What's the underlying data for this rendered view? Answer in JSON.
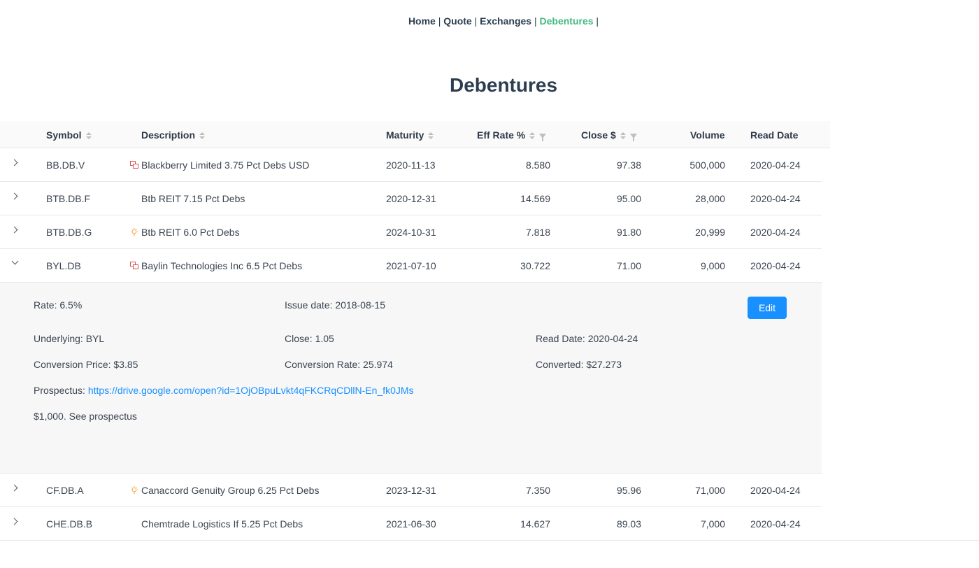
{
  "nav": {
    "home": "Home",
    "quote": "Quote",
    "exchanges": "Exchanges",
    "debentures": "Debentures",
    "sep": "|"
  },
  "page_title": "Debentures",
  "columns": {
    "symbol": "Symbol",
    "description": "Description",
    "maturity": "Maturity",
    "eff_rate": "Eff Rate %",
    "close": "Close $",
    "volume": "Volume",
    "read_date": "Read Date"
  },
  "rows": [
    {
      "symbol": "BB.DB.V",
      "icon": "convert-icon",
      "description": "Blackberry Limited 3.75 Pct Debs USD",
      "maturity": "2020-11-13",
      "eff_rate": "8.580",
      "close": "97.38",
      "volume": "500,000",
      "read_date": "2020-04-24"
    },
    {
      "symbol": "BTB.DB.F",
      "icon": "",
      "description": "Btb REIT 7.15 Pct Debs",
      "maturity": "2020-12-31",
      "eff_rate": "14.569",
      "close": "95.00",
      "volume": "28,000",
      "read_date": "2020-04-24"
    },
    {
      "symbol": "BTB.DB.G",
      "icon": "bulb-icon",
      "description": "Btb REIT 6.0 Pct Debs",
      "maturity": "2024-10-31",
      "eff_rate": "7.818",
      "close": "91.80",
      "volume": "20,999",
      "read_date": "2020-04-24"
    },
    {
      "symbol": "BYL.DB",
      "icon": "convert-icon",
      "description": "Baylin Technologies Inc 6.5 Pct Debs",
      "maturity": "2021-07-10",
      "eff_rate": "30.722",
      "close": "71.00",
      "volume": "9,000",
      "read_date": "2020-04-24"
    },
    {
      "symbol": "CF.DB.A",
      "icon": "bulb-icon",
      "description": "Canaccord Genuity Group 6.25 Pct Debs",
      "maturity": "2023-12-31",
      "eff_rate": "7.350",
      "close": "95.96",
      "volume": "71,000",
      "read_date": "2020-04-24"
    },
    {
      "symbol": "CHE.DB.B",
      "icon": "",
      "description": "Chemtrade Logistics If 5.25 Pct Debs",
      "maturity": "2021-06-30",
      "eff_rate": "14.627",
      "close": "89.03",
      "volume": "7,000",
      "read_date": "2020-04-24"
    }
  ],
  "expanded": {
    "rate": "Rate: 6.5%",
    "issue_date": "Issue date: 2018-08-15",
    "underlying": "Underlying: BYL",
    "close": "Close: 1.05",
    "read_date": "Read Date: 2020-04-24",
    "conversion_price": "Conversion Price: $3.85",
    "conversion_rate": "Conversion Rate: 25.974",
    "converted": "Converted: $27.273",
    "prospectus_label": "Prospectus: ",
    "prospectus_link": "https://drive.google.com/open?id=1OjOBpuLvkt4qFKCRqCDllN-En_fk0JMs",
    "note": "$1,000. See prospectus",
    "edit_label": "Edit"
  },
  "colors": {
    "accent": "#42b983",
    "link": "#1890ff",
    "convert_icon": "#d9534f",
    "bulb_icon": "#f0ad4e"
  }
}
